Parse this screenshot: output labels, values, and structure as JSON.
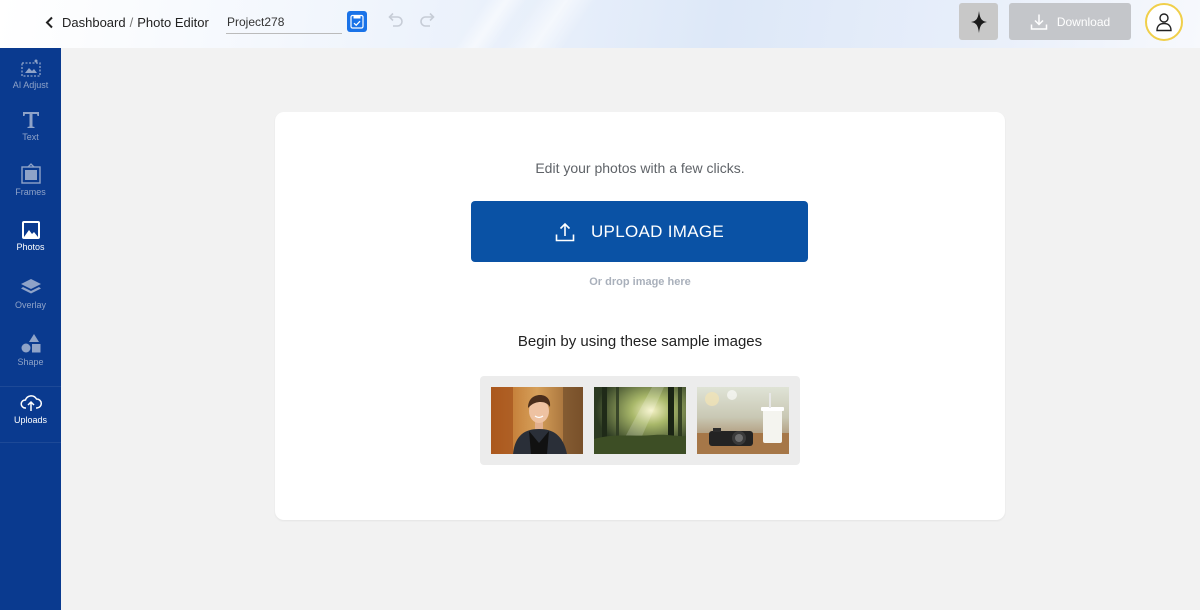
{
  "header": {
    "breadcrumb_root": "Dashboard",
    "breadcrumb_separator": "/",
    "breadcrumb_current": "Photo Editor",
    "project_name": "Project278",
    "download_label": "Download"
  },
  "sidebar": {
    "items": [
      {
        "label": "AI Adjust",
        "icon": "ai-adjust-icon"
      },
      {
        "label": "Text",
        "icon": "text-icon"
      },
      {
        "label": "Frames",
        "icon": "frames-icon"
      },
      {
        "label": "Photos",
        "icon": "photos-icon",
        "active": true
      },
      {
        "label": "Overlay",
        "icon": "overlay-icon"
      },
      {
        "label": "Shape",
        "icon": "shape-icon"
      },
      {
        "label": "Uploads",
        "icon": "upload-cloud-icon"
      }
    ]
  },
  "main": {
    "tagline": "Edit your photos with a few clicks.",
    "upload_label": "UPLOAD IMAGE",
    "drop_hint": "Or drop image here",
    "samples_title": "Begin by using these sample images",
    "samples": [
      {
        "subject": "portrait"
      },
      {
        "subject": "forest"
      },
      {
        "subject": "camera"
      }
    ]
  },
  "colors": {
    "sidebar": "#0a3a8f",
    "primary": "#0a52a5",
    "save_accent": "#1a73e8",
    "download_disabled": "#c4c6ca",
    "avatar_ring": "#f0cf4a"
  }
}
